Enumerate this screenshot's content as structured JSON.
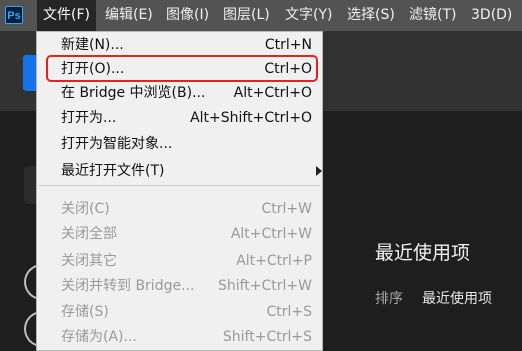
{
  "app": {
    "logo_text": "Ps"
  },
  "menubar": {
    "items": [
      {
        "label": "文件(F)",
        "active": true
      },
      {
        "label": "编辑(E)"
      },
      {
        "label": "图像(I)"
      },
      {
        "label": "图层(L)"
      },
      {
        "label": "文字(Y)"
      },
      {
        "label": "选择(S)"
      },
      {
        "label": "滤镜(T)"
      },
      {
        "label": "3D(D)"
      }
    ]
  },
  "file_menu": {
    "items": [
      {
        "label": "新建(N)...",
        "shortcut": "Ctrl+N",
        "enabled": true
      },
      {
        "label": "打开(O)...",
        "shortcut": "Ctrl+O",
        "enabled": true,
        "highlighted": true
      },
      {
        "label": "在 Bridge 中浏览(B)...",
        "shortcut": "Alt+Ctrl+O",
        "enabled": true
      },
      {
        "label": "打开为...",
        "shortcut": "Alt+Shift+Ctrl+O",
        "enabled": true
      },
      {
        "label": "打开为智能对象...",
        "shortcut": "",
        "enabled": true
      },
      {
        "label": "最近打开文件(T)",
        "shortcut": "",
        "enabled": true,
        "submenu": true
      },
      {
        "label": "关闭(C)",
        "shortcut": "Ctrl+W",
        "enabled": false
      },
      {
        "label": "关闭全部",
        "shortcut": "Alt+Ctrl+W",
        "enabled": false
      },
      {
        "label": "关闭其它",
        "shortcut": "Alt+Ctrl+P",
        "enabled": false
      },
      {
        "label": "关闭并转到 Bridge...",
        "shortcut": "Shift+Ctrl+W",
        "enabled": false
      },
      {
        "label": "存储(S)",
        "shortcut": "Ctrl+S",
        "enabled": false
      },
      {
        "label": "存储为(A)...",
        "shortcut": "Shift+Ctrl+S",
        "enabled": false
      }
    ]
  },
  "home": {
    "recent_title": "最近使用项",
    "sort_label": "排序",
    "sort_value": "最近使用项"
  },
  "colors": {
    "menubar_bg": "#535353",
    "menu_bg": "#f0f0f0",
    "highlight_border": "#e8221b",
    "disabled_text": "#9a9a9a"
  }
}
